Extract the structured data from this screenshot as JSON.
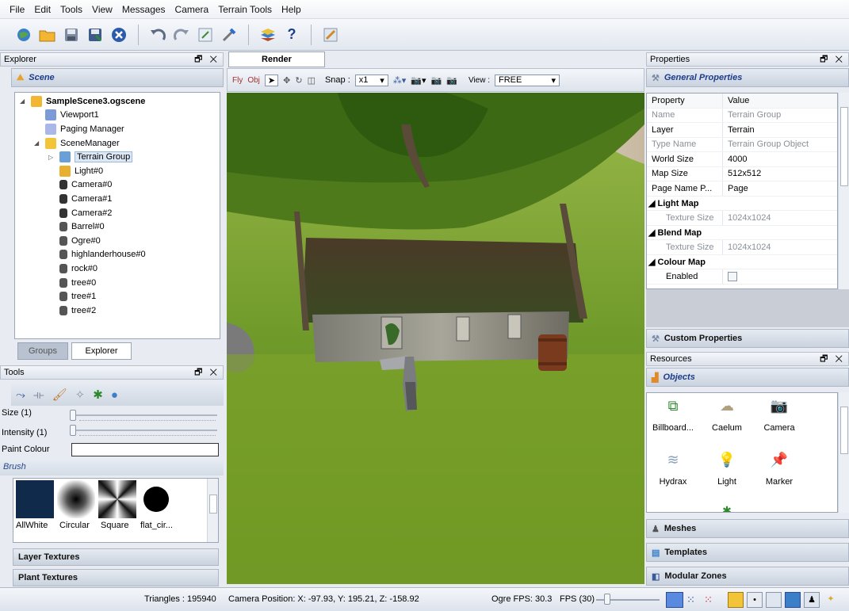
{
  "menu": [
    "File",
    "Edit",
    "Tools",
    "View",
    "Messages",
    "Camera",
    "Terrain Tools",
    "Help"
  ],
  "toolbar": {
    "icons": [
      "globe-icon",
      "open-folder-icon",
      "save-icon",
      "save-as-icon",
      "close-icon",
      "undo-icon",
      "redo-icon",
      "settings-icon",
      "tools-icon",
      "layers-icon",
      "help-icon",
      "paint-icon"
    ],
    "help_glyph": "?"
  },
  "explorer": {
    "title": "Explorer",
    "section": "Scene",
    "tree": [
      {
        "label": "SampleScene3.ogscene",
        "level": 0,
        "bold": true,
        "icon": "folder-icon",
        "expand": "◢"
      },
      {
        "label": "Viewport1",
        "level": 1,
        "icon": "viewport-icon"
      },
      {
        "label": "Paging Manager",
        "level": 1,
        "icon": "grid-icon"
      },
      {
        "label": "SceneManager",
        "level": 1,
        "icon": "scene-manager-icon",
        "expand": "◢"
      },
      {
        "label": "Terrain Group",
        "level": 2,
        "icon": "terrain-icon",
        "expand": "▷",
        "selected": true
      },
      {
        "label": "Light#0",
        "level": 2,
        "icon": "light-icon"
      },
      {
        "label": "Camera#0",
        "level": 2,
        "icon": "camera-icon"
      },
      {
        "label": "Camera#1",
        "level": 2,
        "icon": "camera-icon"
      },
      {
        "label": "Camera#2",
        "level": 2,
        "icon": "camera-icon"
      },
      {
        "label": "Barrel#0",
        "level": 2,
        "icon": "entity-icon"
      },
      {
        "label": "Ogre#0",
        "level": 2,
        "icon": "entity-icon"
      },
      {
        "label": "highlanderhouse#0",
        "level": 2,
        "icon": "entity-icon"
      },
      {
        "label": "rock#0",
        "level": 2,
        "icon": "entity-icon"
      },
      {
        "label": "tree#0",
        "level": 2,
        "icon": "entity-icon"
      },
      {
        "label": "tree#1",
        "level": 2,
        "icon": "entity-icon"
      },
      {
        "label": "tree#2",
        "level": 2,
        "icon": "entity-icon"
      }
    ],
    "tabs": [
      "Groups",
      "Explorer"
    ]
  },
  "tools": {
    "title": "Tools",
    "size_label": "Size (1)",
    "intensity_label": "Intensity (1)",
    "paint_colour_label": "Paint Colour",
    "brush_label": "Brush",
    "brushes": [
      "AllWhite",
      "Circular",
      "Square",
      "flat_cir..."
    ],
    "layer_textures": "Layer Textures",
    "plant_textures": "Plant Textures"
  },
  "render": {
    "tab": "Render",
    "fly": "Fly",
    "obj": "Obj",
    "snap_label": "Snap :",
    "snap_value": "x1",
    "view_label": "View :",
    "view_value": "FREE"
  },
  "properties": {
    "title": "Properties",
    "section": "General Properties",
    "col_property": "Property",
    "col_value": "Value",
    "rows": [
      {
        "k": "Name",
        "v": "Terrain Group",
        "grey": true
      },
      {
        "k": "Layer",
        "v": "Terrain"
      },
      {
        "k": "Type Name",
        "v": "Terrain Group Object",
        "grey": true
      },
      {
        "k": "World Size",
        "v": "4000"
      },
      {
        "k": "Map Size",
        "v": "512x512"
      },
      {
        "k": "Page Name P...",
        "v": "Page"
      },
      {
        "k": "◢ Light Map",
        "v": "",
        "group": true
      },
      {
        "k": "Texture Size",
        "v": "1024x1024",
        "grey": true,
        "indent": true
      },
      {
        "k": "◢ Blend Map",
        "v": "",
        "group": true
      },
      {
        "k": "Texture Size",
        "v": "1024x1024",
        "grey": true,
        "indent": true
      },
      {
        "k": "◢ Colour Map",
        "v": "",
        "group": true
      },
      {
        "k": "Enabled",
        "v": "",
        "checkbox": true,
        "indent": true
      }
    ],
    "custom": "Custom Properties"
  },
  "resources": {
    "title": "Resources",
    "section": "Objects",
    "items": [
      {
        "label": "Billboard...",
        "icon": "billboard-icon"
      },
      {
        "label": "Caelum",
        "icon": "cloud-icon"
      },
      {
        "label": "Camera",
        "icon": "camera-icon"
      },
      {
        "label": "Hydrax",
        "icon": "water-icon"
      },
      {
        "label": "Light",
        "icon": "light-icon"
      },
      {
        "label": "Marker",
        "icon": "pin-icon"
      }
    ],
    "meshes": "Meshes",
    "templates": "Templates",
    "modular_zones": "Modular Zones"
  },
  "status": {
    "triangles": "Triangles : 195940",
    "camera_position": "Camera Position: X: -97.93, Y:  195.21, Z: -158.92",
    "ogre_fps": "Ogre FPS: 30.3",
    "fps_label": "FPS (30)"
  },
  "dock_buttons": "🗗 ✕"
}
